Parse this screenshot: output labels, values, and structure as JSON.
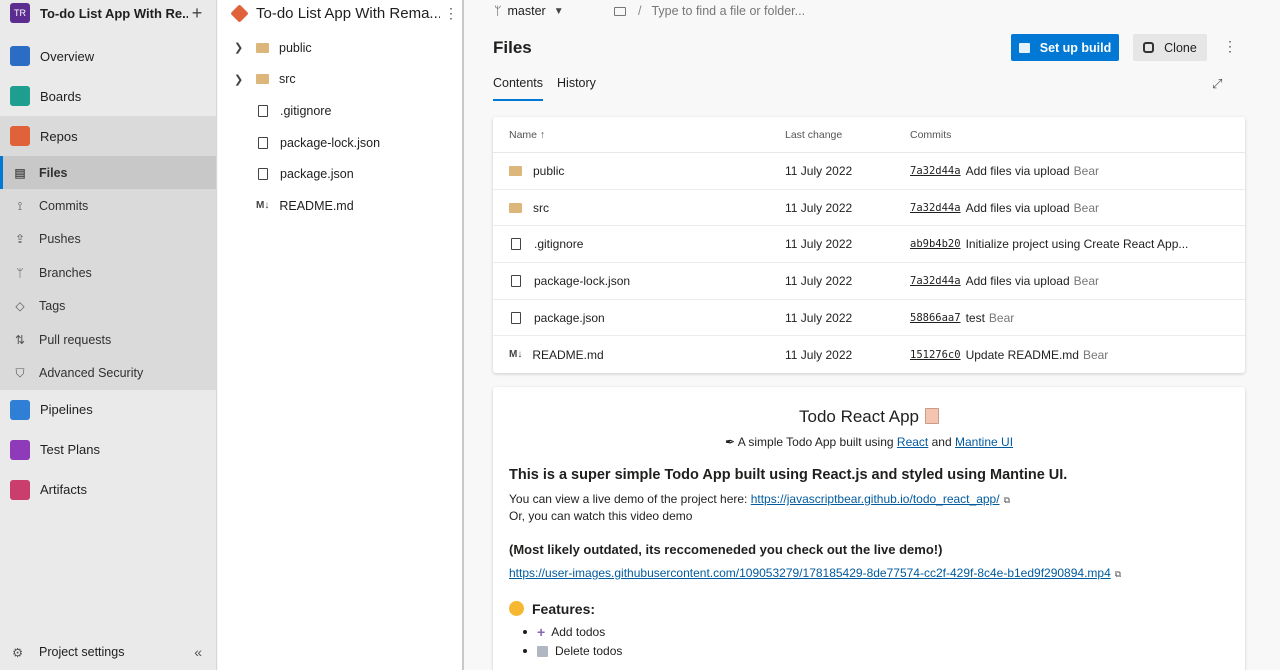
{
  "project": {
    "avatar": "TR",
    "name": "To-do List App With Re..."
  },
  "nav": {
    "items": [
      {
        "label": "Overview",
        "color": "#2b6cc4"
      },
      {
        "label": "Boards",
        "color": "#1d9e8f"
      },
      {
        "label": "Repos",
        "color": "#e0623a"
      }
    ],
    "repo_sub": [
      "Files",
      "Commits",
      "Pushes",
      "Branches",
      "Tags",
      "Pull requests",
      "Advanced Security"
    ],
    "items_after": [
      {
        "label": "Pipelines",
        "color": "#2f7fd6"
      },
      {
        "label": "Test Plans",
        "color": "#8f3ab8"
      },
      {
        "label": "Artifacts",
        "color": "#c93e6c"
      }
    ],
    "settings": "Project settings"
  },
  "tree": {
    "repo_name": "To-do List App With Rema...",
    "items": [
      {
        "name": "public",
        "type": "folder"
      },
      {
        "name": "src",
        "type": "folder"
      },
      {
        "name": ".gitignore",
        "type": "file"
      },
      {
        "name": "package-lock.json",
        "type": "file"
      },
      {
        "name": "package.json",
        "type": "file"
      },
      {
        "name": "README.md",
        "type": "md"
      }
    ]
  },
  "topbar": {
    "branch": "master",
    "path_placeholder": "Type to find a file or folder..."
  },
  "main": {
    "title": "Files",
    "setup_build": "Set up build",
    "clone": "Clone",
    "tabs": [
      "Contents",
      "History"
    ],
    "columns": {
      "name": "Name ↑",
      "last_change": "Last change",
      "commits": "Commits"
    },
    "rows": [
      {
        "name": "public",
        "type": "folder",
        "date": "11 July 2022",
        "hash": "7a32d44a",
        "msg": "Add files via upload",
        "author": "Bear"
      },
      {
        "name": "src",
        "type": "folder",
        "date": "11 July 2022",
        "hash": "7a32d44a",
        "msg": "Add files via upload",
        "author": "Bear"
      },
      {
        "name": ".gitignore",
        "type": "file",
        "date": "11 July 2022",
        "hash": "ab9b4b20",
        "msg": "Initialize project using Create React App...",
        "author": ""
      },
      {
        "name": "package-lock.json",
        "type": "file",
        "date": "11 July 2022",
        "hash": "7a32d44a",
        "msg": "Add files via upload",
        "author": "Bear"
      },
      {
        "name": "package.json",
        "type": "file",
        "date": "11 July 2022",
        "hash": "58866aa7",
        "msg": "test",
        "author": "Bear"
      },
      {
        "name": "README.md",
        "type": "md",
        "date": "11 July 2022",
        "hash": "151276c0",
        "msg": "Update README.md",
        "author": "Bear"
      }
    ]
  },
  "readme": {
    "title": "Todo React App",
    "sub_prefix": "A simple Todo App built using",
    "sub_link1": "React",
    "sub_and": "and",
    "sub_link2": "Mantine UI",
    "heading": "This is a super simple Todo App built using React.js and styled using Mantine UI.",
    "demo_prefix": "You can view a live demo of the project here:",
    "demo_link": "https://javascriptbear.github.io/todo_react_app/",
    "video_line": "Or, you can watch this video demo",
    "outdated": "(Most likely outdated, its reccomeneded you check out the live demo!)",
    "video_link": "https://user-images.githubusercontent.com/109053279/178185429-8de77574-cc2f-429f-8c4e-b1ed9f290894.mp4",
    "features_title": "Features:",
    "features": [
      "Add todos",
      "Delete todos"
    ]
  }
}
